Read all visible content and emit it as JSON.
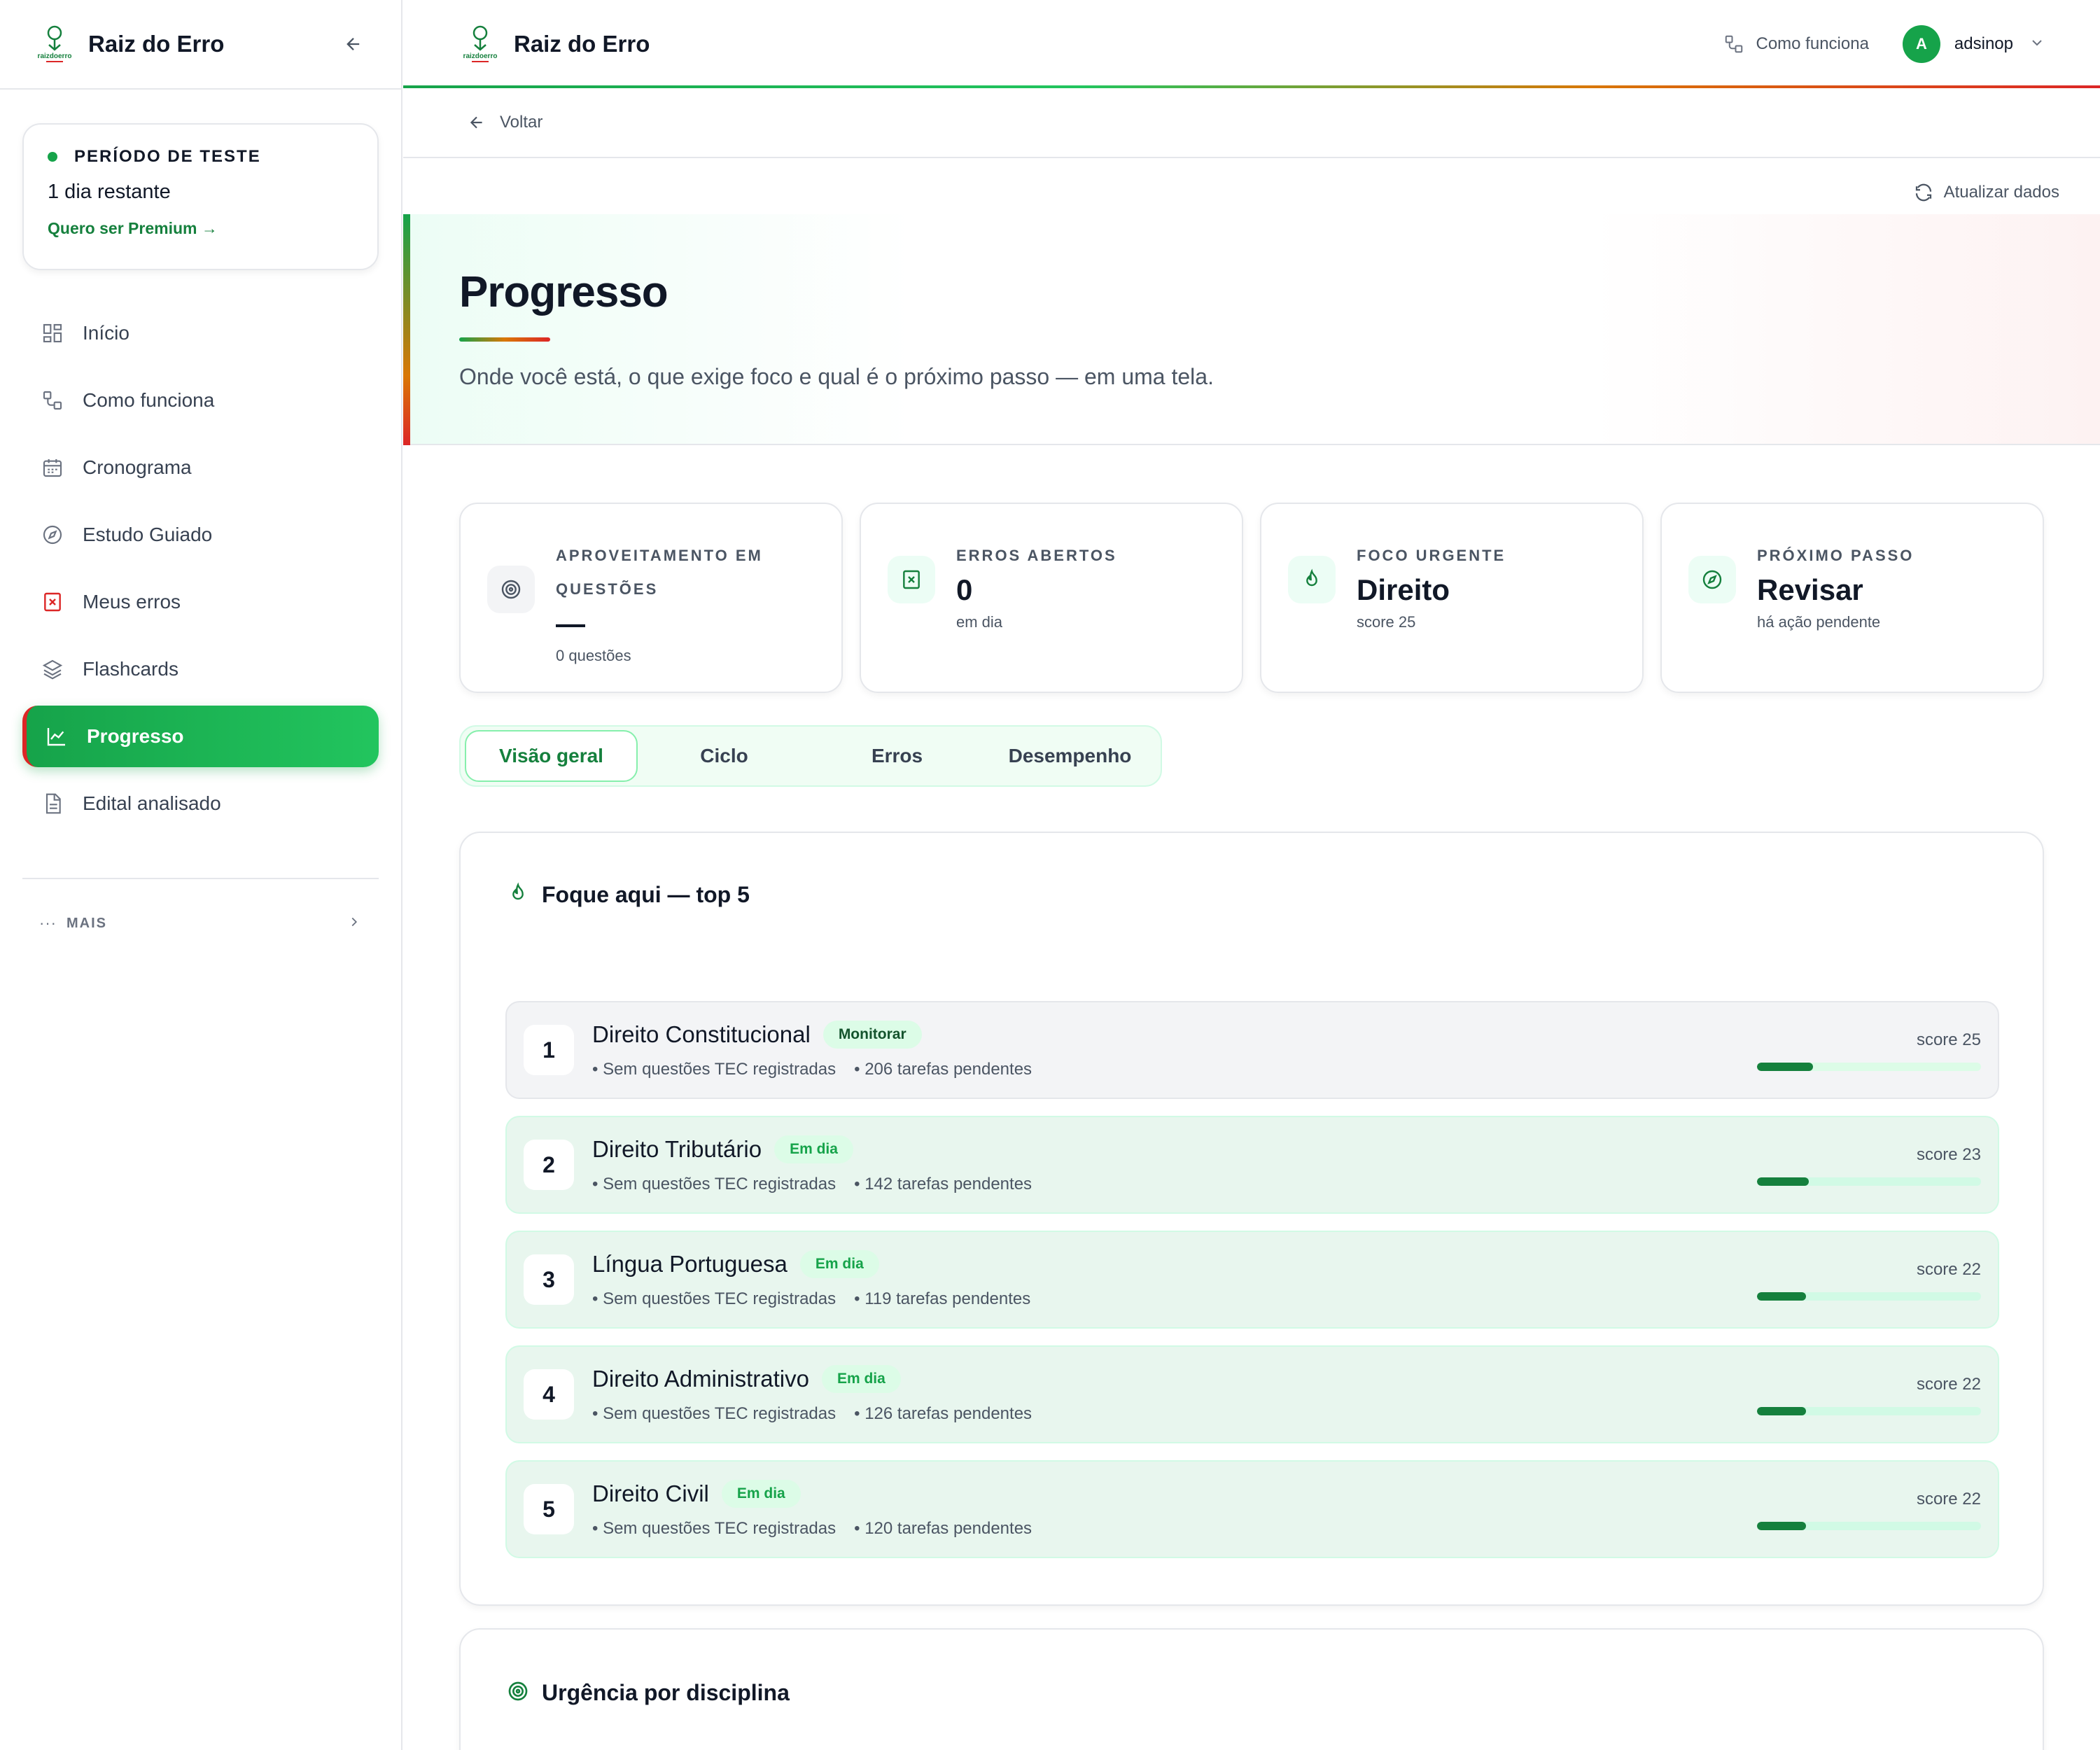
{
  "app": {
    "name": "Raiz do Erro",
    "logo_text": "raizdoerro"
  },
  "sidebar": {
    "trial": {
      "label": "PERÍODO DE TESTE",
      "days": "1 dia restante",
      "cta": "Quero ser Premium →"
    },
    "items": [
      {
        "label": "Início",
        "icon": "grid-icon"
      },
      {
        "label": "Como funciona",
        "icon": "flow-icon"
      },
      {
        "label": "Cronograma",
        "icon": "calendar-icon"
      },
      {
        "label": "Estudo Guiado",
        "icon": "compass-icon"
      },
      {
        "label": "Meus erros",
        "icon": "error-x-icon"
      },
      {
        "label": "Flashcards",
        "icon": "layers-icon"
      },
      {
        "label": "Progresso",
        "icon": "chart-line-icon",
        "active": true
      },
      {
        "label": "Edital analisado",
        "icon": "document-icon"
      }
    ],
    "more": "MAIS"
  },
  "topbar": {
    "how": "Como funciona",
    "avatar": "A",
    "user": "adsinop"
  },
  "back": "Voltar",
  "refresh": "Atualizar dados",
  "hero": {
    "title": "Progresso",
    "subtitle": "Onde você está, o que exige foco e qual é o próximo passo — em uma tela."
  },
  "stats": [
    {
      "label": "APROVEITAMENTO EM QUESTÕES",
      "value": "—",
      "sub": "0 questões"
    },
    {
      "label": "ERROS ABERTOS",
      "value": "0",
      "sub": "em dia"
    },
    {
      "label": "FOCO URGENTE",
      "value": "Direito",
      "sub": "score 25"
    },
    {
      "label": "PRÓXIMO PASSO",
      "value": "Revisar",
      "sub": "há ação pendente"
    }
  ],
  "tabs": [
    "Visão geral",
    "Ciclo",
    "Erros",
    "Desempenho"
  ],
  "focus": {
    "title": "Foque aqui — top 5",
    "rows": [
      {
        "rank": "1",
        "name": "Direito Constitucional",
        "badge": "Monitorar",
        "meta1": "• Sem questões TEC registradas",
        "meta2": "• 206 tarefas pendentes",
        "score": "score 25",
        "fill": 0.25
      },
      {
        "rank": "2",
        "name": "Direito Tributário",
        "badge": "Em dia",
        "meta1": "• Sem questões TEC registradas",
        "meta2": "• 142 tarefas pendentes",
        "score": "score 23",
        "fill": 0.23
      },
      {
        "rank": "3",
        "name": "Língua Portuguesa",
        "badge": "Em dia",
        "meta1": "• Sem questões TEC registradas",
        "meta2": "• 119 tarefas pendentes",
        "score": "score 22",
        "fill": 0.22
      },
      {
        "rank": "4",
        "name": "Direito Administrativo",
        "badge": "Em dia",
        "meta1": "• Sem questões TEC registradas",
        "meta2": "• 126 tarefas pendentes",
        "score": "score 22",
        "fill": 0.22
      },
      {
        "rank": "5",
        "name": "Direito Civil",
        "badge": "Em dia",
        "meta1": "• Sem questões TEC registradas",
        "meta2": "• 120 tarefas pendentes",
        "score": "score 22",
        "fill": 0.22
      }
    ]
  },
  "urgency": {
    "title": "Urgência por disciplina"
  },
  "colors": {
    "brand_green": "#16a34a",
    "accent_red": "#dc2626",
    "accent_amber": "#d97706"
  }
}
